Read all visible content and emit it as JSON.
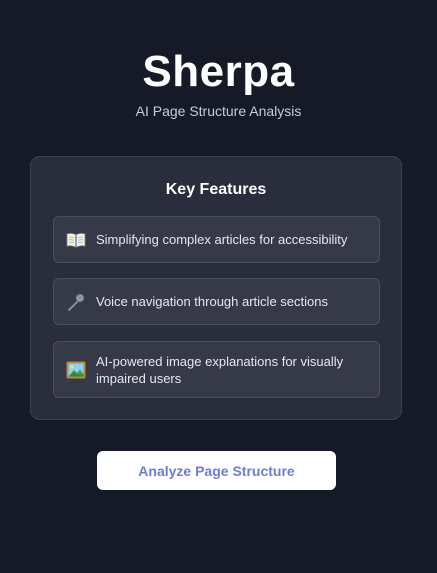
{
  "header": {
    "title": "Sherpa",
    "subtitle": "AI Page Structure Analysis"
  },
  "features_card": {
    "heading": "Key Features",
    "items": [
      {
        "icon": "open-book-icon",
        "text": "Simplifying complex articles for accessibility"
      },
      {
        "icon": "microphone-icon",
        "text": "Voice navigation through article sections"
      },
      {
        "icon": "framed-picture-icon",
        "text": "AI-powered image explanations for visually impaired users"
      }
    ]
  },
  "actions": {
    "analyze_label": "Analyze Page Structure"
  },
  "colors": {
    "background": "#161a27",
    "card": "#2a2d3b",
    "feature_item": "#363948",
    "button_text": "#6d7fc9"
  }
}
